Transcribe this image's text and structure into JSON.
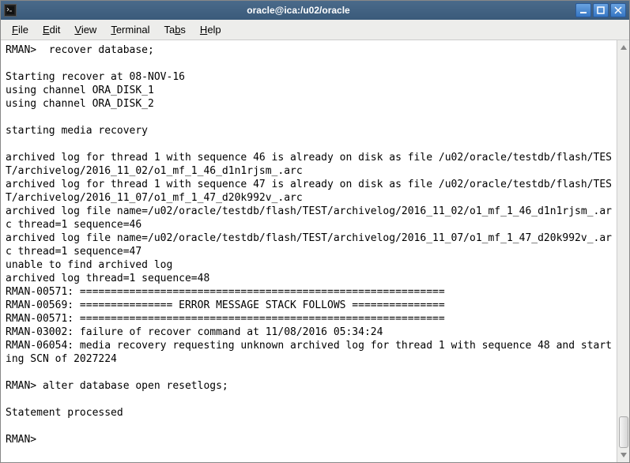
{
  "titlebar": {
    "title": "oracle@ica:/u02/oracle"
  },
  "menubar": {
    "file": "File",
    "edit": "Edit",
    "view": "View",
    "terminal": "Terminal",
    "tabs": "Tabs",
    "help": "Help"
  },
  "terminal": {
    "content": "RMAN>  recover database;\n\nStarting recover at 08-NOV-16\nusing channel ORA_DISK_1\nusing channel ORA_DISK_2\n\nstarting media recovery\n\narchived log for thread 1 with sequence 46 is already on disk as file /u02/oracle/testdb/flash/TEST/archivelog/2016_11_02/o1_mf_1_46_d1n1rjsm_.arc\narchived log for thread 1 with sequence 47 is already on disk as file /u02/oracle/testdb/flash/TEST/archivelog/2016_11_07/o1_mf_1_47_d20k992v_.arc\narchived log file name=/u02/oracle/testdb/flash/TEST/archivelog/2016_11_02/o1_mf_1_46_d1n1rjsm_.arc thread=1 sequence=46\narchived log file name=/u02/oracle/testdb/flash/TEST/archivelog/2016_11_07/o1_mf_1_47_d20k992v_.arc thread=1 sequence=47\nunable to find archived log\narchived log thread=1 sequence=48\nRMAN-00571: ===========================================================\nRMAN-00569: =============== ERROR MESSAGE STACK FOLLOWS ===============\nRMAN-00571: ===========================================================\nRMAN-03002: failure of recover command at 11/08/2016 05:34:24\nRMAN-06054: media recovery requesting unknown archived log for thread 1 with sequence 48 and starting SCN of 2027224\n\nRMAN> alter database open resetlogs;\n\nStatement processed\n\nRMAN> "
  }
}
